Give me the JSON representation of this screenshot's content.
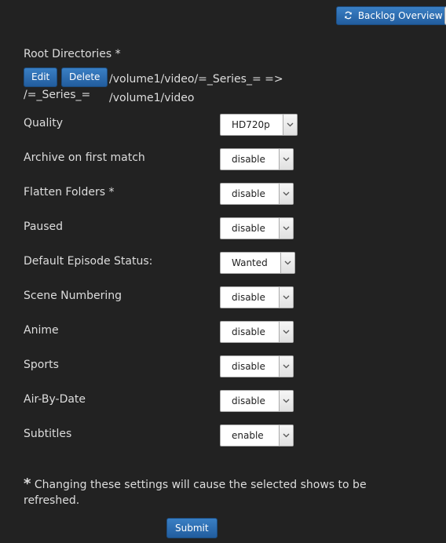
{
  "header": {
    "backlog_button_label": "Backlog Overview",
    "backlog_icon": "refresh-icon"
  },
  "root_directories": {
    "label": "Root Directories *",
    "edit_label": "Edit",
    "delete_label": "Delete",
    "path_line1": "/volume1/video/=_Series_= => /volume1/video",
    "path_line2": "/=_Series_="
  },
  "settings": [
    {
      "label": "Quality",
      "value": "HD720p"
    },
    {
      "label": "Archive on first match",
      "value": "disable"
    },
    {
      "label": "Flatten Folders *",
      "value": "disable"
    },
    {
      "label": "Paused",
      "value": "disable"
    },
    {
      "label": "Default Episode Status:",
      "value": "Wanted"
    },
    {
      "label": "Scene Numbering",
      "value": "disable"
    },
    {
      "label": "Anime",
      "value": "disable"
    },
    {
      "label": "Sports",
      "value": "disable"
    },
    {
      "label": "Air-By-Date",
      "value": "disable"
    },
    {
      "label": "Subtitles",
      "value": "enable"
    }
  ],
  "footnote": {
    "star": "*",
    "text": "Changing these settings will cause the selected shows to be refreshed."
  },
  "submit_label": "Submit",
  "colors": {
    "background": "#222222",
    "accent": "#2b6cb0"
  }
}
